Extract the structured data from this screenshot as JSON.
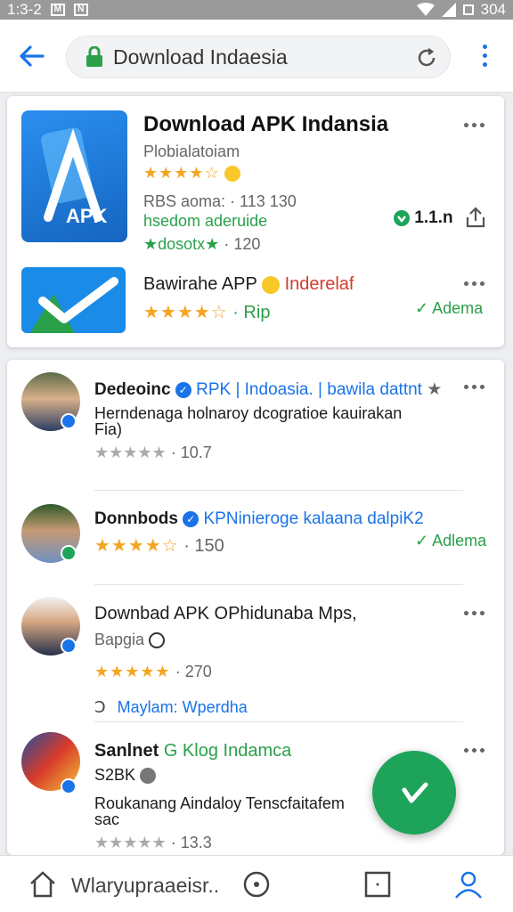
{
  "status_bar": {
    "time": "1:3-2",
    "icon_a": "M",
    "icon_b": "N",
    "battery": "304"
  },
  "browser": {
    "url_text": "Download Indaesia"
  },
  "featured": {
    "app1": {
      "icon_text": "APK",
      "title": "Download APK Indansia",
      "subtitle": "Plobialatoiam",
      "rating_stars": "★★★★☆",
      "meta1": "RBS aoma: · 113 130",
      "meta2": "hsedom aderuide",
      "meta3_stars": "★dosotx★",
      "meta3_count": "· 120",
      "download_count": "1.1.n"
    },
    "app2": {
      "title": "Bawirahe APP",
      "tag": "Inderelaf",
      "rating_stars": "★★★★☆",
      "rating_text": "· Rip",
      "action": "Adema"
    }
  },
  "feed": [
    {
      "name": "Dedeoinc",
      "handle": "RPK | Indoasia. | bawila dattnt",
      "text1": "Herndenaga holnaroy dcogratioe kauirakan",
      "text2": "Fia)",
      "stars": "★★★★★",
      "count": "· 10.7"
    },
    {
      "name": "Donnbods",
      "handle": "KPNinieroge kalaana dalpiK2",
      "stars": "★★★★☆",
      "count": "· 150",
      "action": "Adlema"
    },
    {
      "name": "Downbad APK OPhidunaba Mps,",
      "sub": "Bapgia",
      "stars": "★★★★★",
      "count": "· 270",
      "link": "Maylam: Wperdha"
    },
    {
      "name": "Sanlnet",
      "tag": "G Klog Indamca",
      "sub": "S2BK",
      "text1": "Roukanang Aindaloy Tenscfaitafem",
      "text2": "sac",
      "stars": "★★★★★",
      "count": "· 13.3"
    }
  ],
  "bottom_nav": {
    "search_label": "Wlaryupraaeisr.."
  },
  "colors": {
    "accent": "#1a73e8",
    "green": "#1ea45a",
    "star": "#f4a623"
  }
}
